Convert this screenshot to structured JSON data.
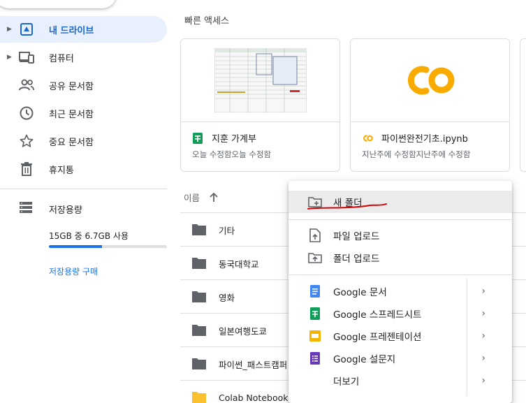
{
  "sidebar": {
    "items": [
      {
        "label": "내 드라이브",
        "icon": "my-drive-icon",
        "active": true,
        "expandable": true
      },
      {
        "label": "컴퓨터",
        "icon": "computer-icon",
        "active": false,
        "expandable": true
      },
      {
        "label": "공유 문서함",
        "icon": "shared-icon",
        "active": false,
        "expandable": false
      },
      {
        "label": "최근 문서함",
        "icon": "clock-icon",
        "active": false,
        "expandable": false
      },
      {
        "label": "중요 문서함",
        "icon": "star-icon",
        "active": false,
        "expandable": false
      },
      {
        "label": "휴지통",
        "icon": "trash-icon",
        "active": false,
        "expandable": false
      }
    ],
    "storage": {
      "label": "저장용량",
      "usage_text": "15GB 중 6.7GB 사용",
      "used_fraction": 0.447,
      "buy_label": "저장용량 구매"
    }
  },
  "quick_access": {
    "title": "빠른 액세스",
    "cards": [
      {
        "name": "지훈 가계부",
        "subtitle": "오늘 수정함오늘 수정함",
        "type": "sheets"
      },
      {
        "name": "파이썬완전기초.ipynb",
        "subtitle": "지난주에 수정함지난주에 수정함",
        "type": "colab"
      }
    ]
  },
  "file_list": {
    "header": "이름",
    "sort_icon": "arrow-up-icon",
    "rows": [
      {
        "name": "기타",
        "color": "#5f6368"
      },
      {
        "name": "동국대학교",
        "color": "#5f6368"
      },
      {
        "name": "영화",
        "color": "#5f6368"
      },
      {
        "name": "일본여행도쿄",
        "color": "#5f6368"
      },
      {
        "name": "파이썬_패스트캠퍼",
        "color": "#5f6368"
      },
      {
        "name": "Colab Notebooks",
        "color": "#fbc02d"
      }
    ]
  },
  "context_menu": {
    "new_folder": "새 폴더",
    "upload_file": "파일 업로드",
    "upload_folder": "폴더 업로드",
    "docs": "Google 문서",
    "sheets": "Google 스프레드시트",
    "slides": "Google 프레젠테이션",
    "forms": "Google 설문지",
    "more": "더보기"
  },
  "colors": {
    "accent": "#1a73e8",
    "active_bg": "#e8f0fe",
    "sheets": "#0f9d58",
    "docs": "#4285f4",
    "slides": "#f4b400",
    "forms": "#673ab7",
    "colab": "#f9ab00",
    "annotation": "#d50000"
  }
}
